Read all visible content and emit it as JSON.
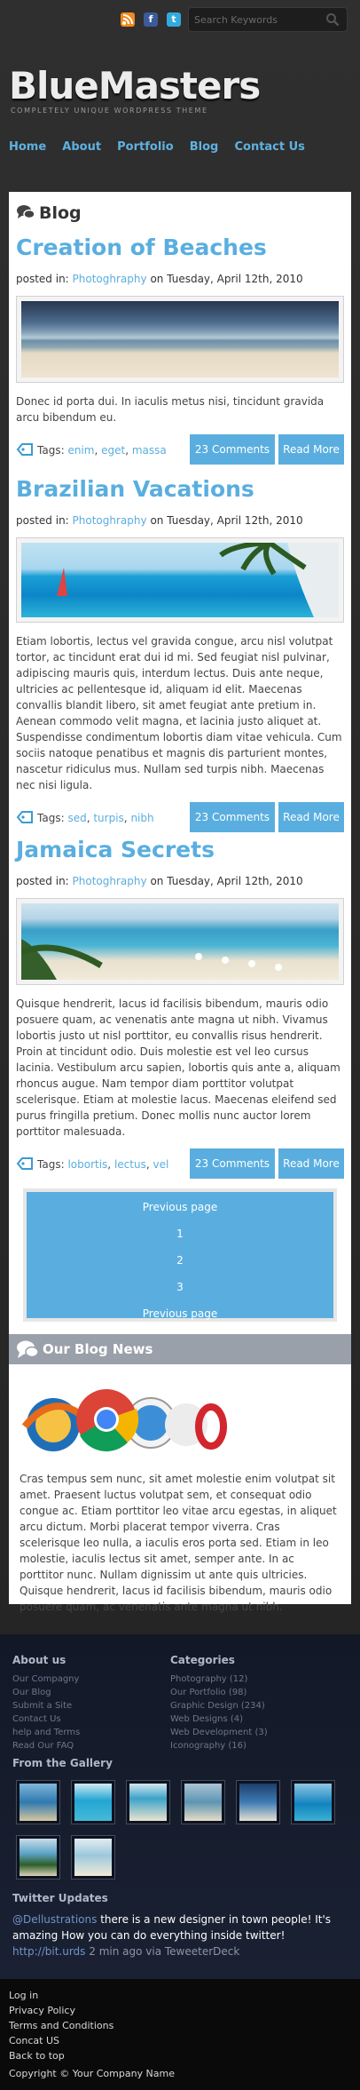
{
  "header": {
    "search_placeholder": "Search Keywords",
    "social": [
      "rss-icon",
      "facebook-icon",
      "twitter-icon"
    ],
    "logo": "BlueMasters",
    "tagline": "COMPLETELY UNIQUE WORDPRESS THEME",
    "nav": [
      "Home",
      "About",
      "Portfolio",
      "Blog",
      "Contact Us"
    ]
  },
  "blog": {
    "heading": "Blog",
    "posted_prefix": "posted in:",
    "tags_prefix": "Tags:",
    "posts": [
      {
        "title": "Creation of Beaches",
        "category": "Photoghraphy",
        "date": "on Tuesday, April 12th, 2010",
        "text": "Donec id porta dui. In iaculis metus nisi, tincidunt gravida arcu bibendum eu.",
        "tags": [
          "enim",
          "eget",
          "massa"
        ],
        "comments": "23 Comments",
        "read_more": "Read More"
      },
      {
        "title": "Brazilian Vacations",
        "category": "Photoghraphy",
        "date": "on Tuesday, April 12th, 2010",
        "text": "Etiam lobortis, lectus vel gravida congue, arcu nisl volutpat tortor, ac tincidunt erat dui id mi. Sed feugiat nisl pulvinar, adipiscing mauris quis, interdum lectus. Duis ante neque, ultricies ac pellentesque id, aliquam id elit. Maecenas convallis blandit libero, sit amet feugiat ante pretium in. Aenean commodo velit magna, et lacinia justo aliquet at. Suspendisse condimentum lobortis diam vitae vehicula. Cum sociis natoque penatibus et magnis dis parturient montes, nascetur ridiculus mus. Nullam sed turpis nibh. Maecenas nec nisi ligula.",
        "tags": [
          "sed",
          "turpis",
          "nibh"
        ],
        "comments": "23 Comments",
        "read_more": "Read More"
      },
      {
        "title": "Jamaica Secrets",
        "category": "Photoghraphy",
        "date": "on Tuesday, April 12th, 2010",
        "text": "Quisque hendrerit, lacus id facilisis bibendum, mauris odio posuere quam, ac venenatis ante magna ut nibh. Vivamus lobortis justo ut nisl porttitor, eu convallis risus hendrerit. Proin at tincidunt odio. Duis molestie est vel leo cursus lacinia. Vestibulum arcu sapien, lobortis quis ante a, aliquam rhoncus augue. Nam tempor diam porttitor volutpat scelerisque. Etiam at molestie lacus. Maecenas eleifend sed purus fringilla pretium. Donec mollis nunc auctor lorem porttitor malesuada.",
        "tags": [
          "lobortis",
          "lectus",
          "vel"
        ],
        "comments": "23 Comments",
        "read_more": "Read More"
      }
    ],
    "pager": [
      "Previous page",
      "1",
      "2",
      "3",
      "Previous page"
    ]
  },
  "blog_news": {
    "heading": "Our Blog News",
    "text": "Cras tempus sem nunc, sit amet molestie enim volutpat sit amet. Praesent luctus volutpat sem, et consequat odio congue ac. Etiam porttitor leo vitae arcu egestas, in aliquet arcu dictum. Morbi placerat tempor viverra. Cras scelerisque leo nulla, a iaculis eros porta sed. Etiam in leo molestie, iaculis lectus sit amet, semper ante. In ac porttitor nunc. Nullam dignissim ut ante quis ultricies. Quisque hendrerit, lacus id facilisis bibendum, mauris odio posuere quam, ac venenatis ante magna ut nibh."
  },
  "footer": {
    "about_title": "About us",
    "about_links": [
      "Our Compagny",
      "Our Blog",
      "Submit a Site",
      "Contact Us",
      "help and Terms",
      "Read Our FAQ"
    ],
    "categories_title": "Categories",
    "categories": [
      "Photography (12)",
      "Our Portfolio (98)",
      "Graphic Design (234)",
      "Web Designs (4)",
      "Web Development (3)",
      "Iconography (16)"
    ],
    "gallery_title": "From the Gallery",
    "twitter_title": "Twitter Updates",
    "tweet_handle": "@Dellustrations",
    "tweet_text": " there is a new designer in town people! It's amazing How you can do everything inside twitter! ",
    "tweet_link": "http://bit.urds",
    "tweet_time": " 2 min ago via TeweeterDeck",
    "bottom_links": [
      "Log in",
      "Privacy Policy",
      "Terms and Conditions",
      "Concat US",
      "Back to top"
    ],
    "copyright": "Copyright © Your Company Name"
  }
}
